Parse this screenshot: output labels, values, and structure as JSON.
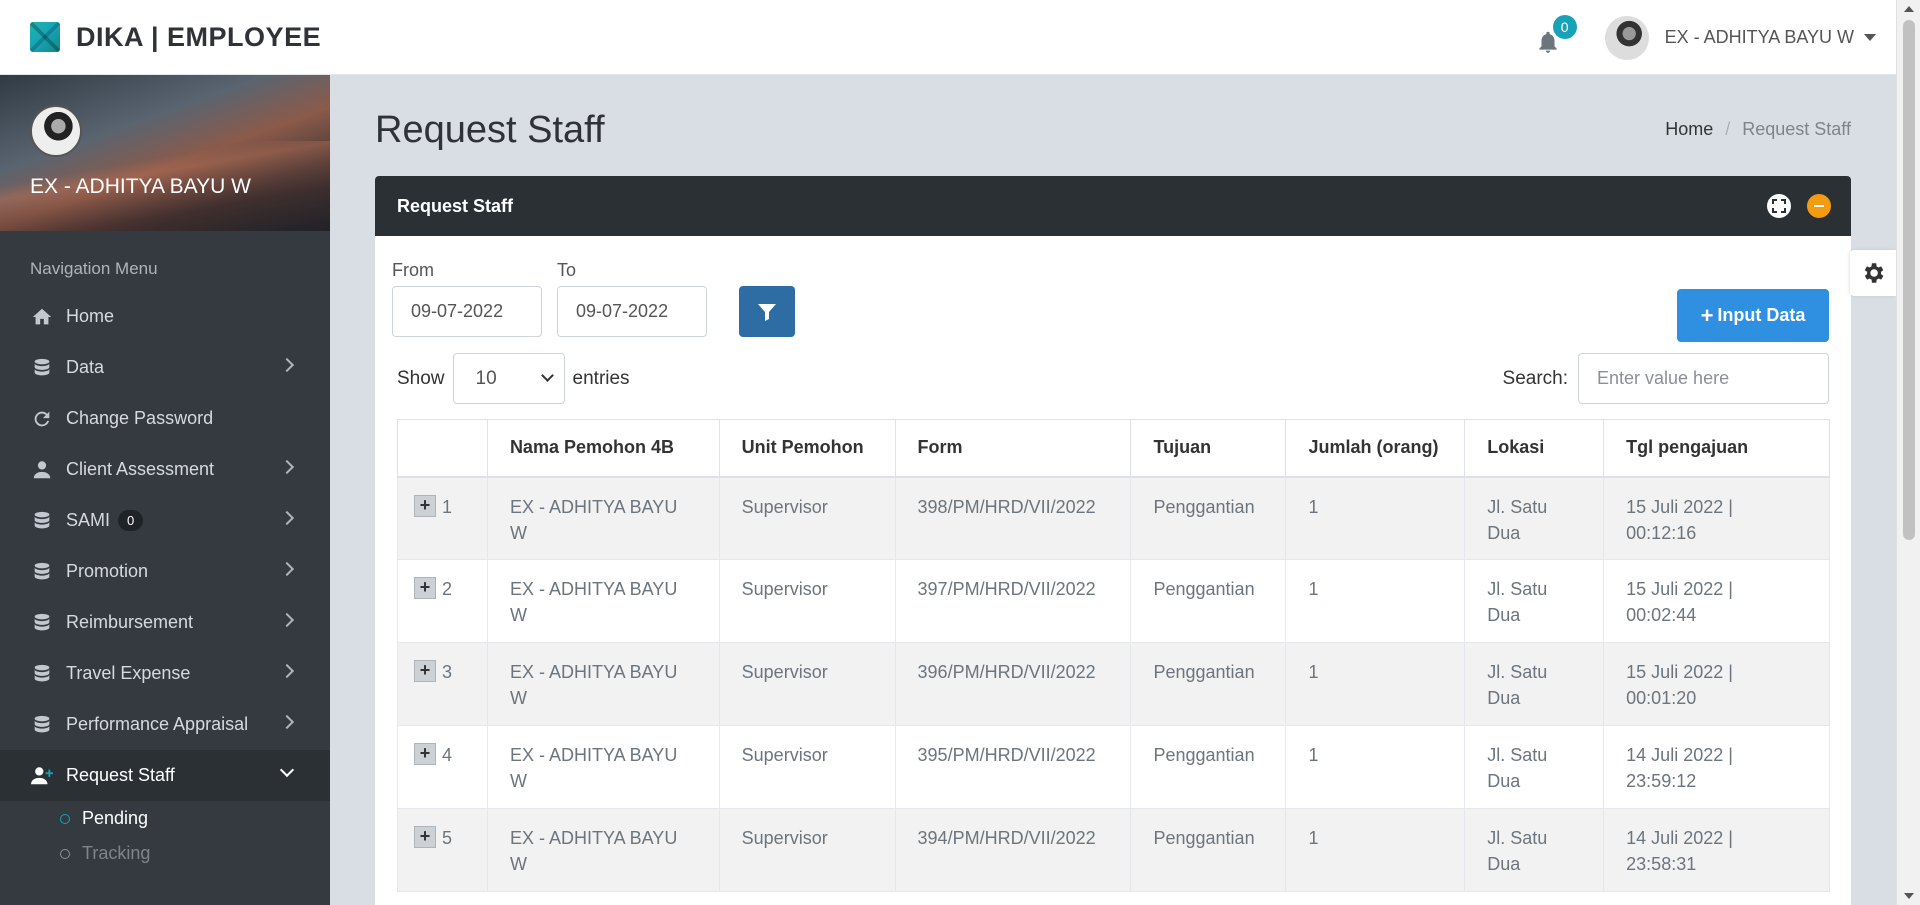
{
  "app": {
    "brand": "DIKA | EMPLOYEE",
    "notification_count": "0",
    "user_name": "EX - ADHITYA BAYU W"
  },
  "sidebar": {
    "profile_name": "EX - ADHITYA BAYU W",
    "nav_header": "Navigation Menu",
    "items": [
      {
        "label": "Home",
        "icon": "home-icon"
      },
      {
        "label": "Data",
        "icon": "database-icon"
      },
      {
        "label": "Change Password",
        "icon": "refresh-icon"
      },
      {
        "label": "Client Assessment",
        "icon": "user-icon"
      },
      {
        "label": "SAMI",
        "icon": "database-icon",
        "badge": "0"
      },
      {
        "label": "Promotion",
        "icon": "database-icon"
      },
      {
        "label": "Reimbursement",
        "icon": "database-icon"
      },
      {
        "label": "Travel Expense",
        "icon": "database-icon"
      },
      {
        "label": "Performance Appraisal",
        "icon": "database-icon"
      },
      {
        "label": "Request Staff",
        "icon": "user-plus-icon"
      }
    ],
    "subitems": [
      {
        "label": "Pending"
      },
      {
        "label": "Tracking"
      }
    ]
  },
  "page": {
    "title": "Request Staff",
    "breadcrumb": [
      "Home",
      "/",
      "Request Staff"
    ]
  },
  "card": {
    "title": "Request Staff",
    "from_label": "From",
    "from_value": "09-07-2022",
    "to_label": "To",
    "to_value": "09-07-2022",
    "input_button": "Input Data",
    "show_label": "Show",
    "entries_value": "10",
    "entries_label": "entries",
    "search_label": "Search:",
    "search_placeholder": "Enter value here"
  },
  "table": {
    "headers": [
      "",
      "Nama Pemohon 4B",
      "Unit Pemohon",
      "Form",
      "Tujuan",
      "Jumlah (orang)",
      "Lokasi",
      "Tgl pengajuan"
    ],
    "rows": [
      {
        "no": "1",
        "nama": "EX - ADHITYA BAYU W",
        "unit": "Supervisor",
        "form": "398/PM/HRD/VII/2022",
        "tujuan": "Penggantian",
        "jumlah": "1",
        "lokasi": "Jl. Satu Dua",
        "tgl": "15 Juli 2022 | 00:12:16"
      },
      {
        "no": "2",
        "nama": "EX - ADHITYA BAYU W",
        "unit": "Supervisor",
        "form": "397/PM/HRD/VII/2022",
        "tujuan": "Penggantian",
        "jumlah": "1",
        "lokasi": "Jl. Satu Dua",
        "tgl": "15 Juli 2022 | 00:02:44"
      },
      {
        "no": "3",
        "nama": "EX - ADHITYA BAYU W",
        "unit": "Supervisor",
        "form": "396/PM/HRD/VII/2022",
        "tujuan": "Penggantian",
        "jumlah": "1",
        "lokasi": "Jl. Satu Dua",
        "tgl": "15 Juli 2022 | 00:01:20"
      },
      {
        "no": "4",
        "nama": "EX - ADHITYA BAYU W",
        "unit": "Supervisor",
        "form": "395/PM/HRD/VII/2022",
        "tujuan": "Penggantian",
        "jumlah": "1",
        "lokasi": "Jl. Satu Dua",
        "tgl": "14 Juli 2022 | 23:59:12"
      },
      {
        "no": "5",
        "nama": "EX - ADHITYA BAYU W",
        "unit": "Supervisor",
        "form": "394/PM/HRD/VII/2022",
        "tujuan": "Penggantian",
        "jumlah": "1",
        "lokasi": "Jl. Satu Dua",
        "tgl": "14 Juli 2022 | 23:58:31"
      }
    ]
  },
  "colors": {
    "sidebar_bg": "#343a40",
    "card_header_bg": "#2b3035",
    "primary": "#2f8fe0",
    "filter_button": "#2e6da4",
    "badge_teal": "#17a2b8",
    "minimize_orange": "#f39c12"
  }
}
